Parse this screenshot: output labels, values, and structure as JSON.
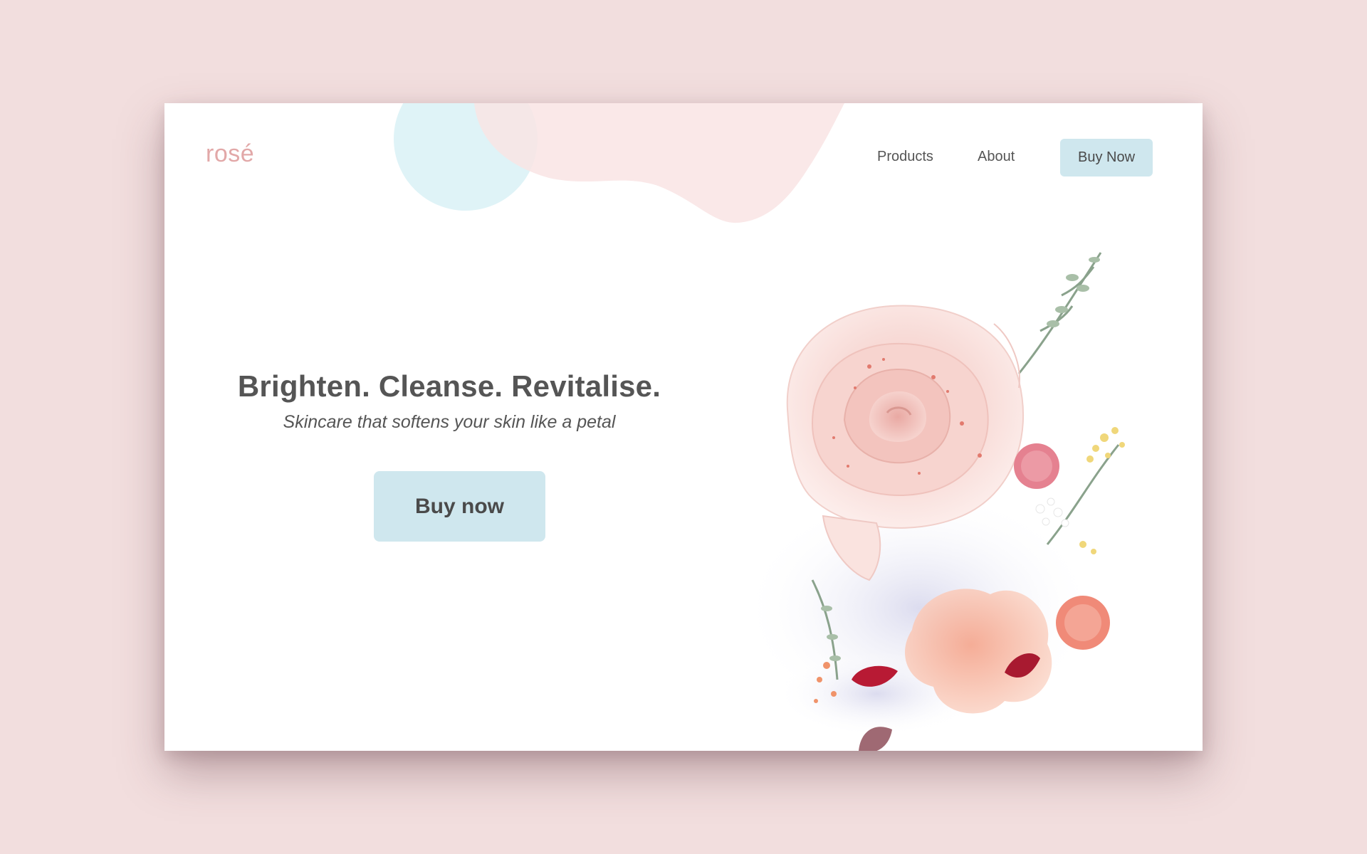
{
  "brand": {
    "name": "rosé"
  },
  "nav": {
    "items": [
      {
        "label": "Products"
      },
      {
        "label": "About"
      }
    ],
    "cta_label": "Buy Now"
  },
  "hero": {
    "title": "Brighten. Cleanse. Revitalise.",
    "subtitle": "Skincare that softens your skin like a petal",
    "cta_label": "Buy now",
    "image_subject": "pink rose bouquet with dried flowers and petals"
  },
  "colors": {
    "page_background": "#f2dede",
    "card_background": "#ffffff",
    "brand_pink": "#e2a8a8",
    "button_blue": "#cfe7ee",
    "blob_blue": "#dff3f7",
    "blob_pink": "#f9e4e4",
    "text_gray": "#555555"
  },
  "icons": {
    "hero_image": "rose-bouquet-illustration"
  }
}
